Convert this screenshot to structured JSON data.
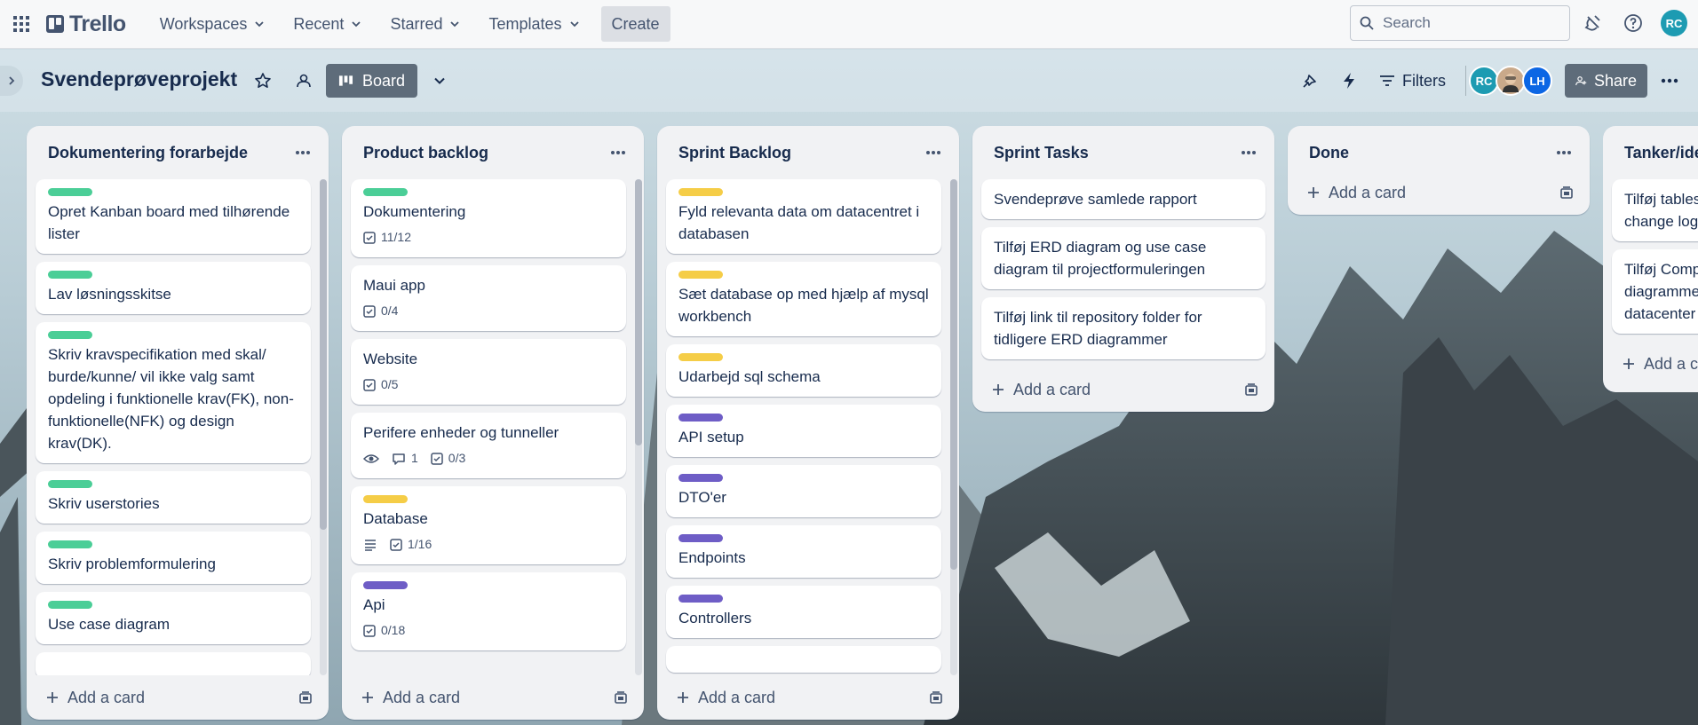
{
  "topnav": {
    "logo_text": "Trello",
    "menus": [
      "Workspaces",
      "Recent",
      "Starred",
      "Templates"
    ],
    "create_label": "Create",
    "search_placeholder": "Search",
    "user_initials": "RC"
  },
  "board": {
    "title": "Svendeprøveprojekt",
    "view_label": "Board",
    "filters_label": "Filters",
    "share_label": "Share",
    "members": [
      "RC",
      "LH"
    ]
  },
  "colors": {
    "green": "#4bce97",
    "yellow": "#f5cd47",
    "purple": "#9f8fef",
    "purple_dark": "#6e5dc6",
    "accent_teal": "#1d9bb2",
    "lh_blue": "#0c66e4"
  },
  "add_card_label": "Add a card",
  "lists": [
    {
      "title": "Dokumentering forarbejde",
      "cards": [
        {
          "label": "green",
          "text": "Opret Kanban board med tilhørende lister"
        },
        {
          "label": "green",
          "text": "Lav løsningsskitse"
        },
        {
          "label": "green",
          "text": "Skriv kravspecifikation med skal/ burde/kunne/ vil ikke valg samt opdeling i funktionelle krav(FK), non-funktionelle(NFK) og design krav(DK)."
        },
        {
          "label": "green",
          "text": "Skriv userstories"
        },
        {
          "label": "green",
          "text": "Skriv problemformulering"
        },
        {
          "label": "green",
          "text": "Use case diagram"
        }
      ]
    },
    {
      "title": "Product backlog",
      "cards": [
        {
          "label": "green",
          "text": "Dokumentering",
          "checklist": "11/12"
        },
        {
          "text": "Maui app",
          "checklist": "0/4"
        },
        {
          "text": "Website",
          "checklist": "0/5"
        },
        {
          "text": "Perifere enheder og tunneller",
          "watch": true,
          "comments": "1",
          "checklist": "0/3"
        },
        {
          "label": "yellow",
          "text": "Database",
          "description": true,
          "checklist": "1/16"
        },
        {
          "label": "purple",
          "text": "Api",
          "checklist": "0/18"
        }
      ]
    },
    {
      "title": "Sprint Backlog",
      "cards": [
        {
          "label": "yellow",
          "text": "Fyld relevanta data om datacentret i databasen"
        },
        {
          "label": "yellow",
          "text": "Sæt database op med hjælp af mysql workbench"
        },
        {
          "label": "yellow",
          "text": "Udarbejd sql schema"
        },
        {
          "label": "purple",
          "text": "API setup"
        },
        {
          "label": "purple",
          "text": "DTO'er"
        },
        {
          "label": "purple",
          "text": "Endpoints"
        },
        {
          "label": "purple",
          "text": "Controllers"
        }
      ]
    },
    {
      "title": "Sprint Tasks",
      "cards": [
        {
          "text": "Svendeprøve samlede rapport"
        },
        {
          "text": "Tilføj ERD diagram og use case diagram til projectformuleringen"
        },
        {
          "text": "Tilføj link til repository folder for tidligere ERD diagrammer"
        }
      ]
    },
    {
      "title": "Done",
      "cards": []
    },
    {
      "title": "Tanker/ide",
      "cards": [
        {
          "text": "Tilføj tables change log"
        },
        {
          "text": "Tilføj Comp diagramme datacenter"
        }
      ]
    }
  ]
}
